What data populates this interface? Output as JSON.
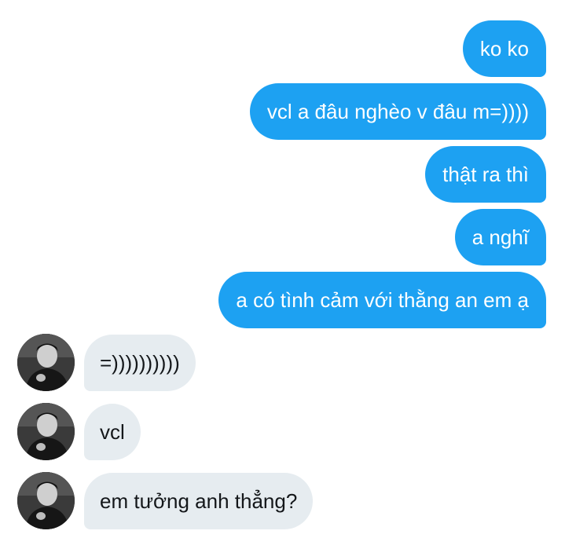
{
  "conversation": {
    "messages": [
      {
        "direction": "outgoing",
        "text": "ko ko"
      },
      {
        "direction": "outgoing",
        "text": "vcl a đâu nghèo v đâu m=))))"
      },
      {
        "direction": "outgoing",
        "text": "thật ra thì"
      },
      {
        "direction": "outgoing",
        "text": "a nghĩ"
      },
      {
        "direction": "outgoing",
        "text": "a có tình cảm với thằng an em ạ"
      },
      {
        "direction": "incoming",
        "text": "=))))))))))"
      },
      {
        "direction": "incoming",
        "text": "vcl"
      },
      {
        "direction": "incoming",
        "text": "em tưởng anh thẳng?"
      }
    ]
  },
  "colors": {
    "outgoing_bubble": "#1da1f2",
    "incoming_bubble": "#e6ecf0",
    "outgoing_text": "#ffffff",
    "incoming_text": "#14171a"
  },
  "icons": {
    "avatar": "user-avatar-photo"
  }
}
